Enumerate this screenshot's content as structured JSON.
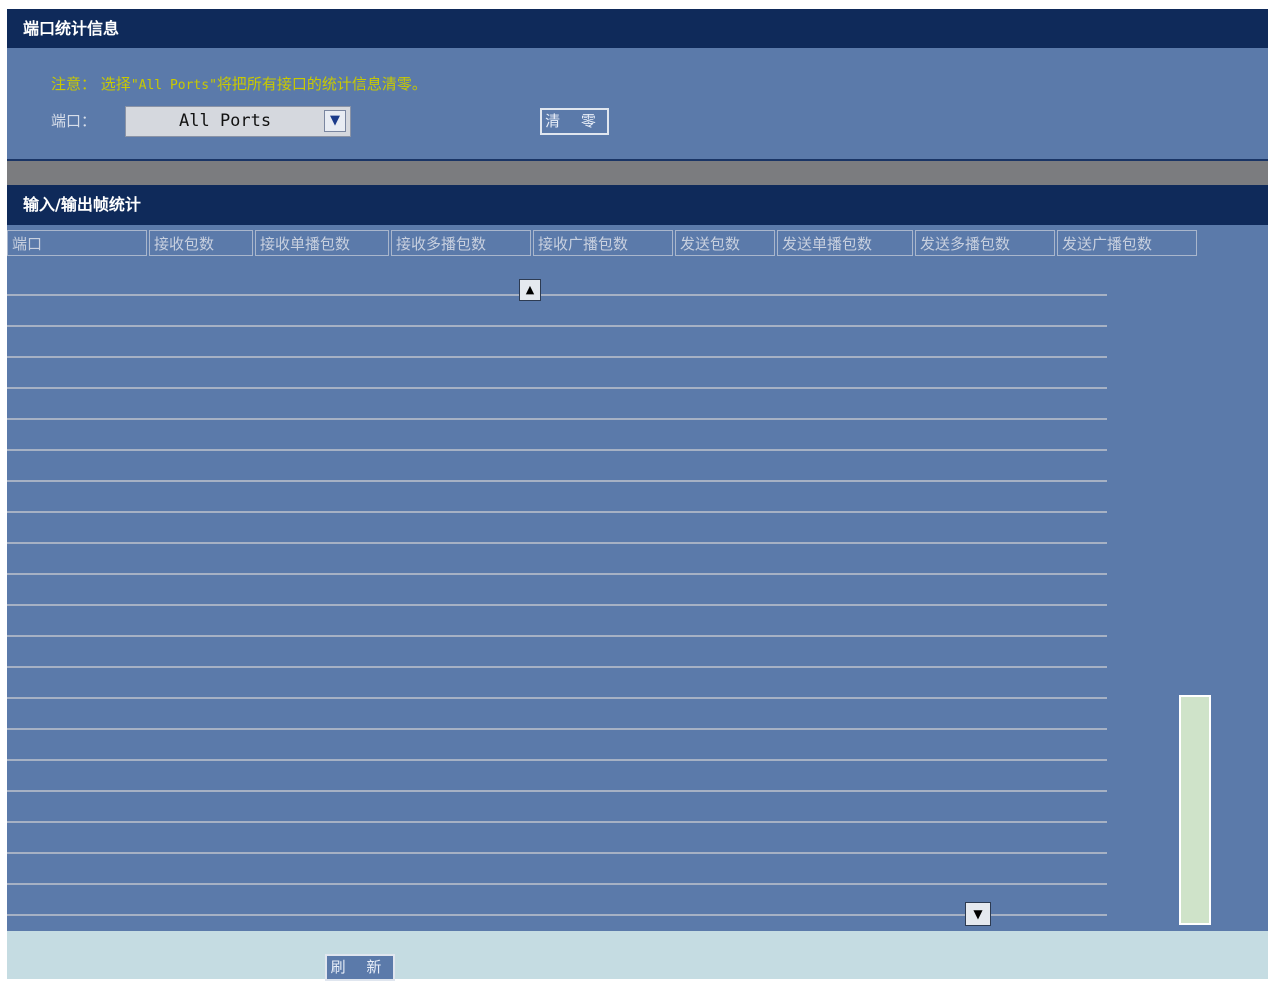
{
  "port_stats_panel": {
    "title": "端口统计信息",
    "notice_prefix": "注意：",
    "notice_text": "选择",
    "notice_quoted": "\"All Ports\"",
    "notice_suffix": "将把所有接口的统计信息清零。",
    "port_label": "端口：",
    "port_select_value": "All Ports",
    "clear_button": "清 零"
  },
  "io_stats_panel": {
    "title": "输入/输出帧统计",
    "columns": [
      "端口",
      "接收包数",
      "接收单播包数",
      "接收多播包数",
      "接收广播包数",
      "发送包数",
      "发送单播包数",
      "发送多播包数",
      "发送广播包数"
    ]
  },
  "footer": {
    "refresh_button": "刷 新"
  }
}
